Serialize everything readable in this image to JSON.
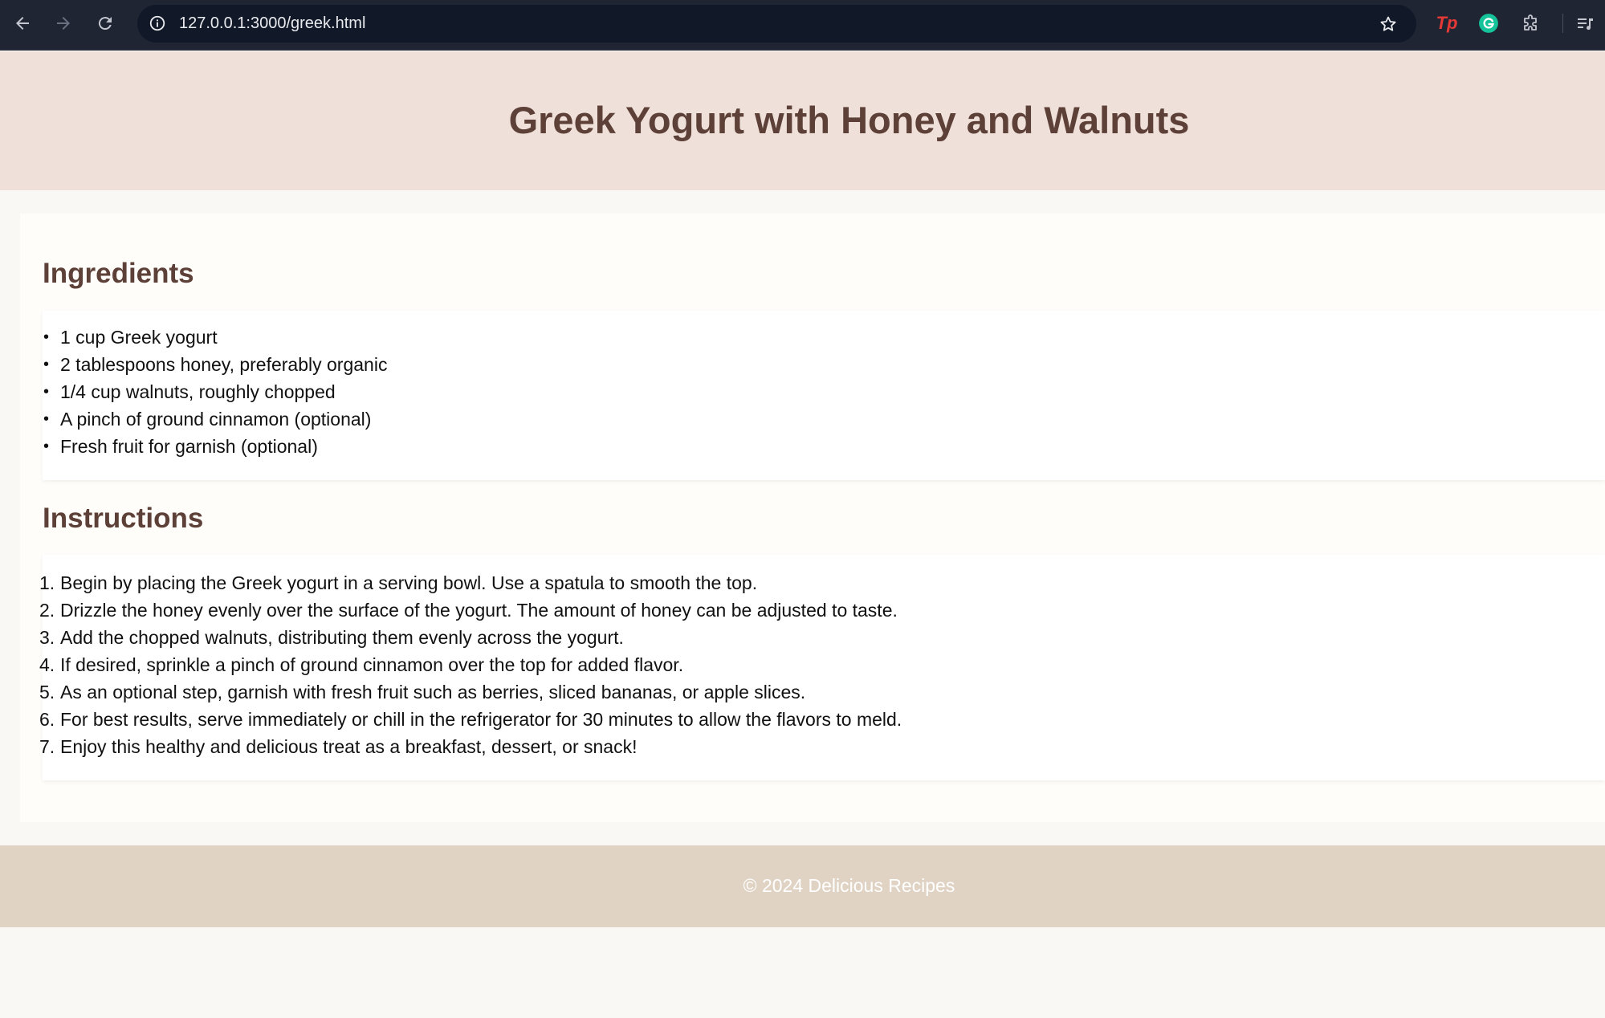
{
  "browser": {
    "url": "127.0.0.1:3000/greek.html",
    "icons": {
      "back": "arrow-left-icon",
      "forward": "arrow-right-icon",
      "reload": "reload-icon",
      "site_info": "info-icon",
      "bookmark": "star-icon",
      "ext_tp": "Tp",
      "ext_grammarly": "grammarly-icon",
      "extensions": "puzzle-icon",
      "media": "media-queue-icon"
    }
  },
  "page": {
    "title": "Greek Yogurt with Honey and Walnuts",
    "ingredients": {
      "heading": "Ingredients",
      "items": [
        "1 cup Greek yogurt",
        "2 tablespoons honey, preferably organic",
        "1/4 cup walnuts, roughly chopped",
        "A pinch of ground cinnamon (optional)",
        "Fresh fruit for garnish (optional)"
      ]
    },
    "instructions": {
      "heading": "Instructions",
      "steps": [
        "Begin by placing the Greek yogurt in a serving bowl. Use a spatula to smooth the top.",
        "Drizzle the honey evenly over the surface of the yogurt. The amount of honey can be adjusted to taste.",
        "Add the chopped walnuts, distributing them evenly across the yogurt.",
        "If desired, sprinkle a pinch of ground cinnamon over the top for added flavor.",
        "As an optional step, garnish with fresh fruit such as berries, sliced bananas, or apple slices.",
        "For best results, serve immediately or chill in the refrigerator for 30 minutes to allow the flavors to meld.",
        "Enjoy this healthy and delicious treat as a breakfast, dessert, or snack!"
      ]
    },
    "footer": "© 2024 Delicious Recipes"
  },
  "colors": {
    "header_bg": "#efe1d9",
    "heading_text": "#5d4037",
    "footer_bg": "#e0d3c4",
    "chrome_bg": "#202534"
  }
}
